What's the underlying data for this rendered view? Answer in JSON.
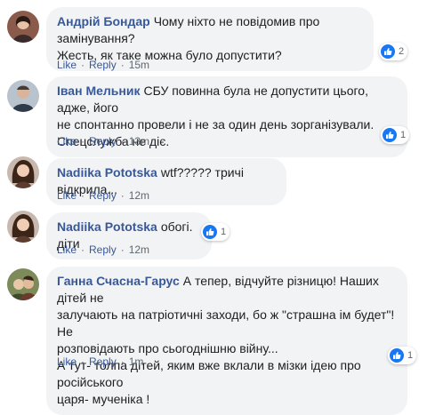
{
  "comments": [
    {
      "author": "Андрій Бондар",
      "text": "Чому ніхто не повідомив про замінування?\nЖесть, як таке можна було допустити?",
      "like_label": "Like",
      "reply_label": "Reply",
      "time": "15m",
      "reactions": "2"
    },
    {
      "author": "Іван Мельник",
      "text": "СБУ повинна була не допустити цього, адже, його\nне спонтанно провели і не за один день зорганізували.\nСпецслужба не діє.",
      "like_label": "Like",
      "reply_label": "Reply",
      "time": "13m",
      "reactions": "1"
    },
    {
      "author": "Nadiika Pototska",
      "text": "wtf????? тричі відкрила...",
      "like_label": "Like",
      "reply_label": "Reply",
      "time": "12m",
      "reactions": ""
    },
    {
      "author": "Nadiika Pototska",
      "text": "обогі. діти",
      "like_label": "Like",
      "reply_label": "Reply",
      "time": "12m",
      "reactions": "1"
    },
    {
      "author": "Ганна Счасна-Гарус",
      "text": "А тепер, відчуйте різницю! Наших дітей не\nзалучають на патріотичні заходи, бо ж \"страшна ім будет\"! Не\nрозповідають про сьогоднішню війну...\nА тут- толпа дітей, яким вже вклали в мізки ідею про російського\nцаря- мученіка !",
      "like_label": "Like",
      "reply_label": "Reply",
      "time": "1m",
      "reactions": "1"
    }
  ],
  "colors": {
    "author": "#385898",
    "bubble": "#f2f3f5",
    "like_blue": "#1877f2",
    "meta": "#606770"
  },
  "icons": [
    "avatar",
    "like-reaction-icon"
  ]
}
